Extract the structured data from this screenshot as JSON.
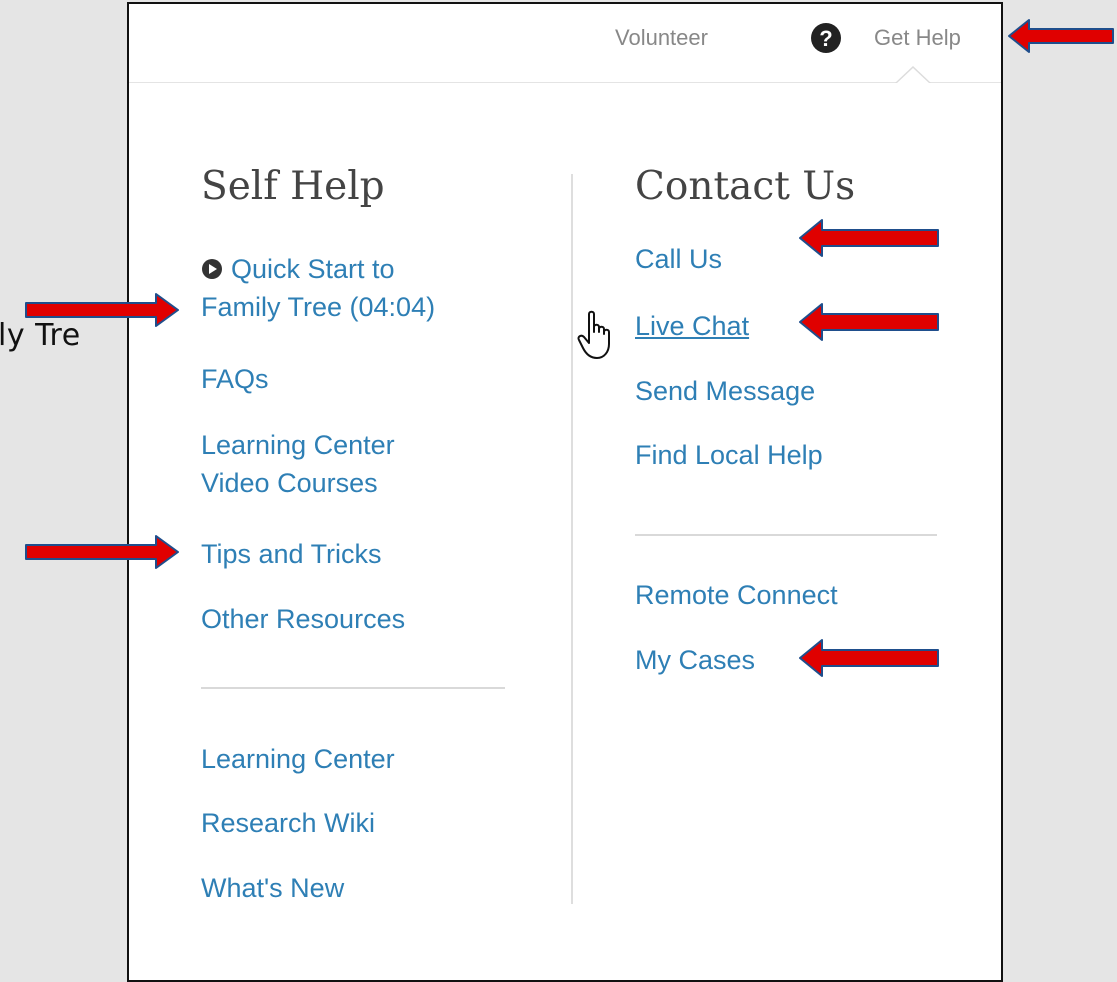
{
  "background_text": "ly Tre",
  "topbar": {
    "volunteer": "Volunteer",
    "get_help": "Get Help"
  },
  "self_help": {
    "heading": "Self Help",
    "quick_start_line1": "Quick Start to",
    "quick_start_line2": "Family Tree (04:04)",
    "faqs": "FAQs",
    "learning_center_video_line1": "Learning Center",
    "learning_center_video_line2": "Video Courses",
    "tips": "Tips and Tricks",
    "other": "Other Resources",
    "learning_center": "Learning Center",
    "research_wiki": "Research Wiki",
    "whats_new": "What's New"
  },
  "contact_us": {
    "heading": "Contact Us",
    "call_us": "Call Us",
    "live_chat": "Live Chat",
    "send_message": "Send Message",
    "find_local_help": "Find Local Help",
    "remote_connect": "Remote Connect",
    "my_cases": "My Cases"
  },
  "colors": {
    "link": "#2e7fb5",
    "arrow": "#e00000",
    "arrow_outline": "#1f4e8c"
  },
  "icons": [
    "question-circle-icon",
    "play-circle-icon",
    "hand-cursor-icon",
    "red-arrow-icon"
  ]
}
